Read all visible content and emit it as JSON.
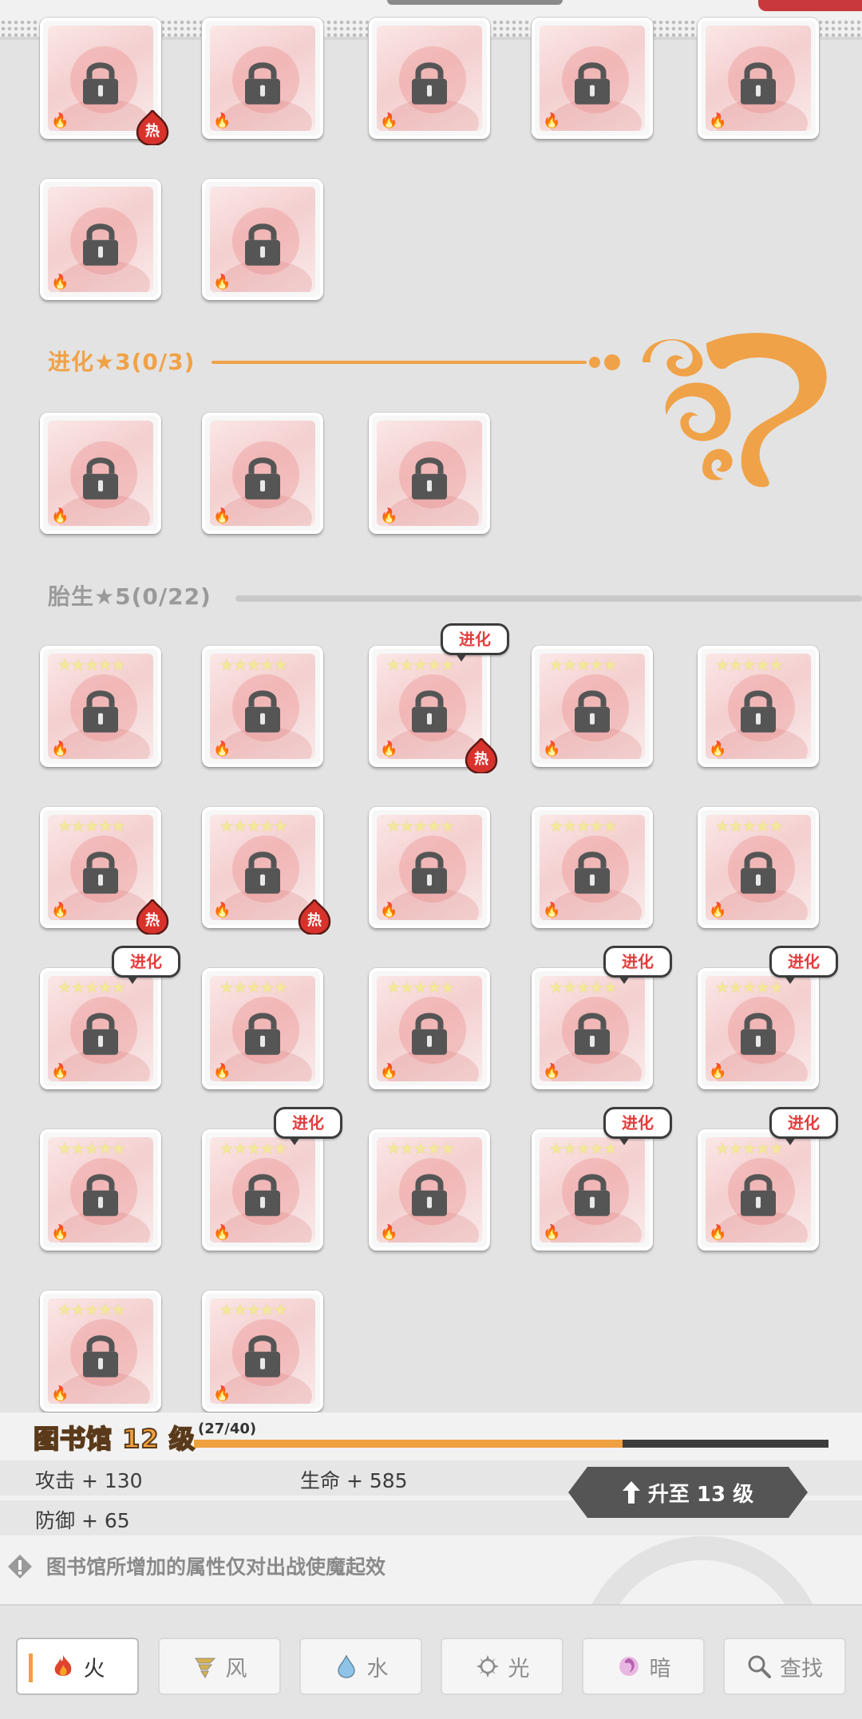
{
  "badge_hot": "热",
  "badge_evolve": "进化",
  "sections": [
    {
      "title": "进化★3(0/3)",
      "color": "#f0a248"
    },
    {
      "title": "胎生★5(0/22)",
      "color": "#9a9a9a"
    }
  ],
  "cards": {
    "row0": [
      {
        "hot": true
      },
      {},
      {},
      {},
      {}
    ],
    "row1": [
      {},
      {}
    ],
    "evo3": [
      {},
      {},
      {}
    ],
    "born5": [
      [
        {},
        {},
        {
          "evolve": true,
          "hot": true
        },
        {},
        {}
      ],
      [
        {
          "hot": true
        },
        {
          "hot": true
        },
        {},
        {},
        {}
      ],
      [
        {
          "evolve": true
        },
        {},
        {},
        {
          "evolve": true
        },
        {
          "evolve": true
        }
      ],
      [
        {},
        {
          "evolve": true
        },
        {},
        {
          "evolve": true
        },
        {
          "evolve": true
        }
      ],
      [
        {},
        {}
      ]
    ],
    "stars": "★★★★★",
    "element": "fire"
  },
  "library": {
    "title": "图书馆 12 级",
    "progress_label": "(27/40)",
    "progress": 0.675,
    "attack": "攻击 + 130",
    "hp": "生命 + 585",
    "defense": "防御 + 65",
    "upgrade_label": "升至 13 级",
    "notice": "图书馆所增加的属性仅对出战使魔起效"
  },
  "tabs": [
    {
      "label": "火",
      "icon": "fire-icon",
      "active": true
    },
    {
      "label": "风",
      "icon": "wind-icon"
    },
    {
      "label": "水",
      "icon": "water-icon"
    },
    {
      "label": "光",
      "icon": "light-icon"
    },
    {
      "label": "暗",
      "icon": "dark-icon"
    },
    {
      "label": "查找",
      "icon": "search-icon"
    }
  ],
  "colors": {
    "accent": "#f0a040",
    "hot": "#d8322c",
    "evolve_text": "#e23d3d"
  }
}
